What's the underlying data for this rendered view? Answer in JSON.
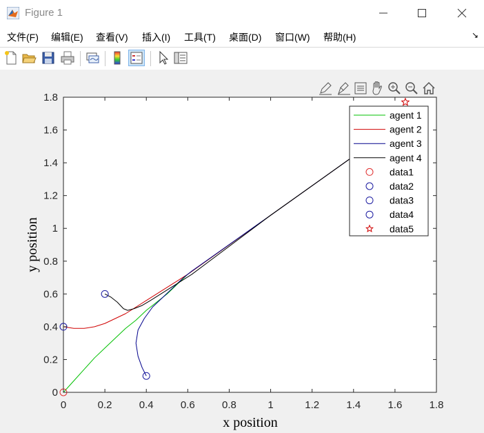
{
  "window": {
    "title": "Figure 1",
    "minimize_glyph": "—",
    "maximize_glyph": "☐",
    "close_glyph": "✕"
  },
  "menubar": {
    "items": [
      {
        "label": "文件(F)"
      },
      {
        "label": "编辑(E)"
      },
      {
        "label": "查看(V)"
      },
      {
        "label": "插入(I)"
      },
      {
        "label": "工具(T)"
      },
      {
        "label": "桌面(D)"
      },
      {
        "label": "窗口(W)"
      },
      {
        "label": "帮助(H)"
      }
    ],
    "overflow_glyph": "↘"
  },
  "toolbar": {
    "icons": [
      "new-figure-icon",
      "open-icon",
      "save-icon",
      "print-icon",
      "link-icon",
      "colorbar-icon",
      "legend-icon",
      "pointer-icon",
      "property-editor-icon"
    ]
  },
  "axes_toolbar": {
    "icons": [
      "edit-icon",
      "brush-icon",
      "data-tip-icon",
      "pan-icon",
      "zoom-in-icon",
      "zoom-out-icon",
      "home-icon"
    ]
  },
  "chart_data": {
    "type": "line",
    "xlabel": "x position",
    "ylabel": "y position",
    "xlim": [
      0,
      1.8
    ],
    "ylim": [
      0,
      1.8
    ],
    "x_ticks": [
      "0",
      "0.2",
      "0.4",
      "0.6",
      "0.8",
      "1",
      "1.2",
      "1.4",
      "1.6",
      "1.8"
    ],
    "y_ticks": [
      "0",
      "0.2",
      "0.4",
      "0.6",
      "0.8",
      "1",
      "1.2",
      "1.4",
      "1.6",
      "1.8"
    ],
    "grid": false,
    "legend_position": "top-right",
    "series": [
      {
        "name": "agent 1",
        "style": "line",
        "color": "#00c000",
        "points": [
          [
            0,
            0
          ],
          [
            0.05,
            0.07
          ],
          [
            0.1,
            0.14
          ],
          [
            0.15,
            0.21
          ],
          [
            0.2,
            0.27
          ],
          [
            0.25,
            0.33
          ],
          [
            0.3,
            0.39
          ],
          [
            0.35,
            0.44
          ],
          [
            0.4,
            0.5
          ],
          [
            0.45,
            0.55
          ],
          [
            0.5,
            0.6
          ],
          [
            0.55,
            0.66
          ],
          [
            0.6,
            0.72
          ],
          [
            1.0,
            1.08
          ],
          [
            1.4,
            1.44
          ],
          [
            1.65,
            1.7
          ]
        ]
      },
      {
        "name": "agent 2",
        "style": "line",
        "color": "#d00000",
        "points": [
          [
            0,
            0.4
          ],
          [
            0.05,
            0.39
          ],
          [
            0.1,
            0.39
          ],
          [
            0.15,
            0.4
          ],
          [
            0.2,
            0.42
          ],
          [
            0.25,
            0.45
          ],
          [
            0.3,
            0.48
          ],
          [
            0.35,
            0.52
          ],
          [
            0.4,
            0.56
          ],
          [
            0.45,
            0.6
          ],
          [
            0.5,
            0.64
          ],
          [
            0.55,
            0.68
          ],
          [
            0.6,
            0.72
          ],
          [
            1.0,
            1.08
          ],
          [
            1.4,
            1.44
          ],
          [
            1.65,
            1.7
          ]
        ]
      },
      {
        "name": "agent 3",
        "style": "line",
        "color": "#00008b",
        "points": [
          [
            0.4,
            0.1
          ],
          [
            0.38,
            0.15
          ],
          [
            0.36,
            0.22
          ],
          [
            0.35,
            0.3
          ],
          [
            0.36,
            0.38
          ],
          [
            0.39,
            0.45
          ],
          [
            0.43,
            0.52
          ],
          [
            0.48,
            0.58
          ],
          [
            0.53,
            0.64
          ],
          [
            0.58,
            0.7
          ],
          [
            0.62,
            0.74
          ],
          [
            1.0,
            1.08
          ],
          [
            1.4,
            1.44
          ],
          [
            1.65,
            1.7
          ]
        ]
      },
      {
        "name": "agent 4",
        "style": "line",
        "color": "#000000",
        "points": [
          [
            0.2,
            0.6
          ],
          [
            0.23,
            0.58
          ],
          [
            0.26,
            0.55
          ],
          [
            0.29,
            0.51
          ],
          [
            0.31,
            0.5
          ],
          [
            0.34,
            0.51
          ],
          [
            0.38,
            0.53
          ],
          [
            0.42,
            0.56
          ],
          [
            0.47,
            0.6
          ],
          [
            0.52,
            0.64
          ],
          [
            0.57,
            0.68
          ],
          [
            0.62,
            0.72
          ],
          [
            1.0,
            1.08
          ],
          [
            1.4,
            1.44
          ],
          [
            1.65,
            1.7
          ]
        ]
      },
      {
        "name": "data1",
        "style": "circle",
        "color": "#e03030",
        "points": [
          [
            0,
            0
          ]
        ]
      },
      {
        "name": "data2",
        "style": "circle",
        "color": "#1a1aa0",
        "points": [
          [
            0,
            0.4
          ]
        ]
      },
      {
        "name": "data3",
        "style": "circle",
        "color": "#1a1aa0",
        "points": [
          [
            0.4,
            0.1
          ]
        ]
      },
      {
        "name": "data4",
        "style": "circle",
        "color": "#1a1aa0",
        "points": [
          [
            0.2,
            0.6
          ]
        ]
      },
      {
        "name": "data5",
        "style": "star",
        "color": "#d00000",
        "points": [
          [
            1.65,
            1.77
          ]
        ]
      }
    ]
  }
}
